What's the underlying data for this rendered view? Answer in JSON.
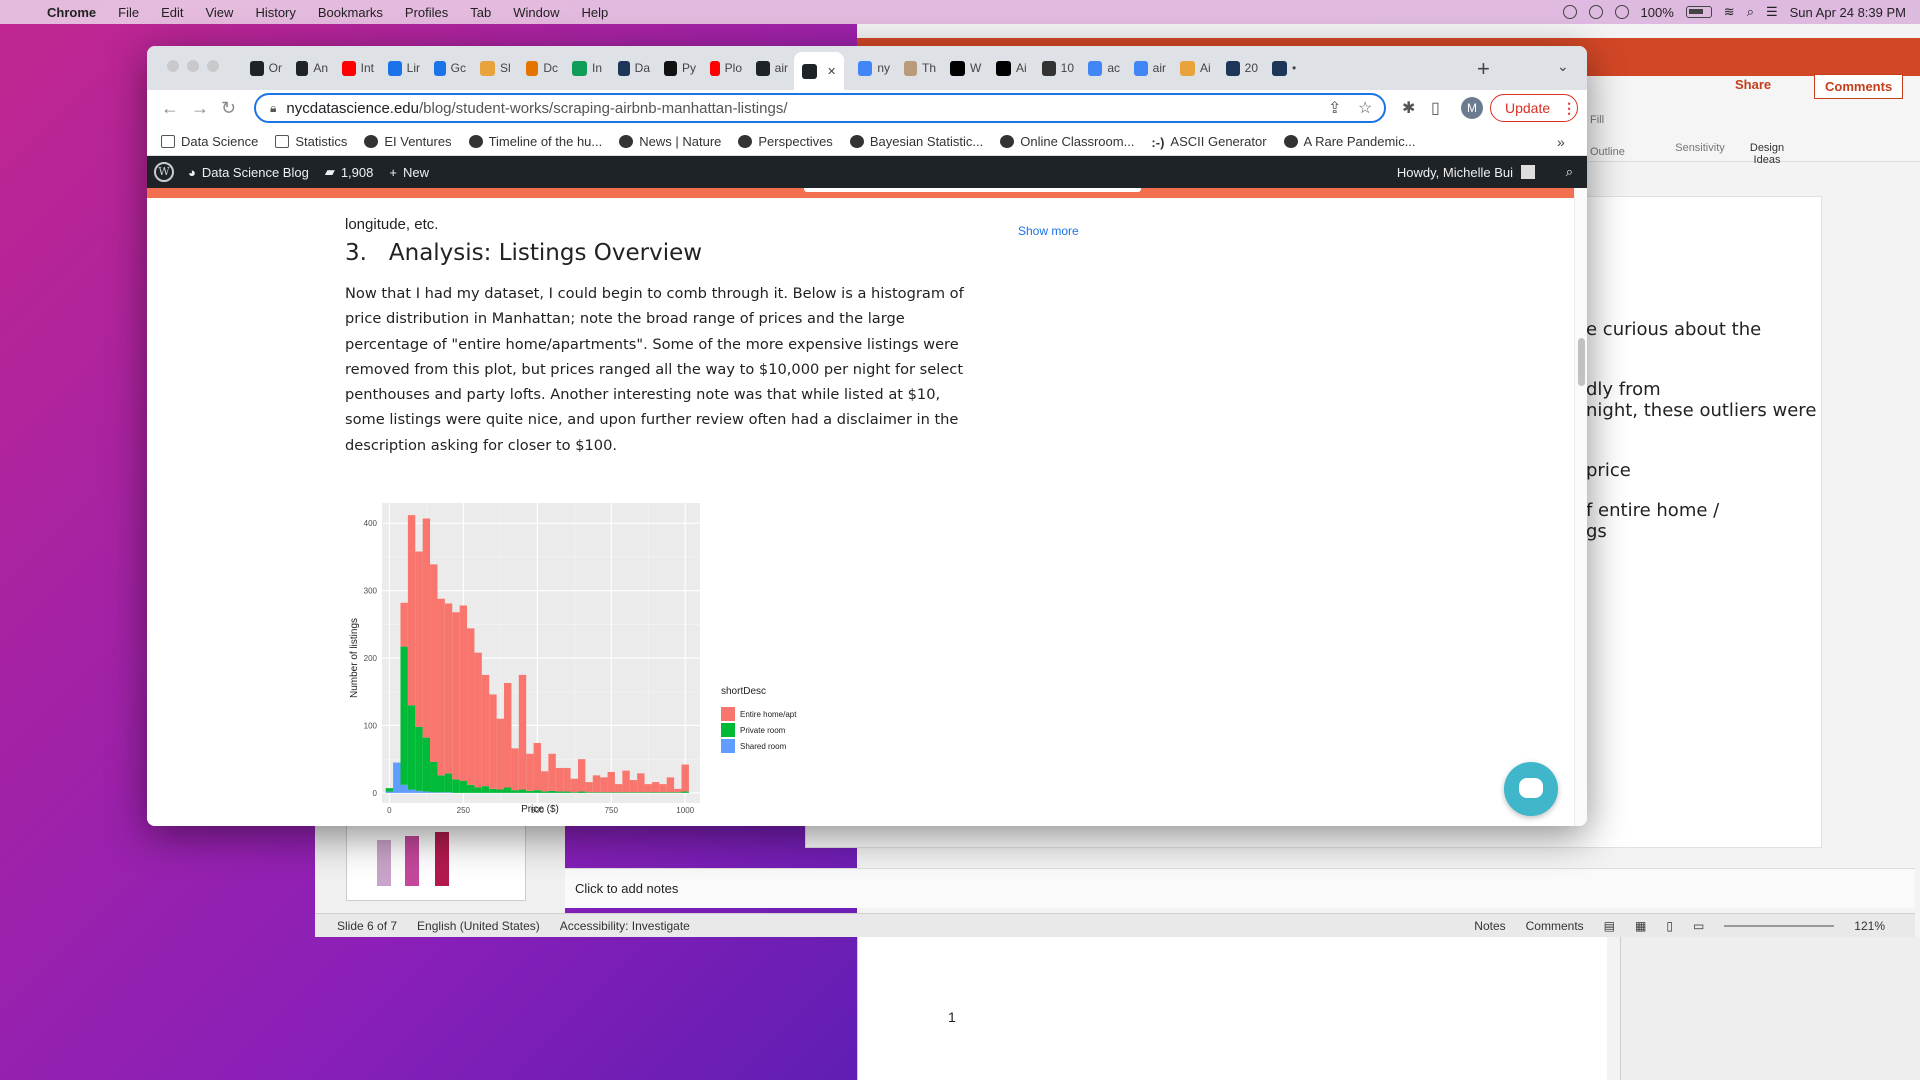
{
  "menubar": {
    "app": "Chrome",
    "items": [
      "File",
      "Edit",
      "View",
      "History",
      "Bookmarks",
      "Profiles",
      "Tab",
      "Window",
      "Help"
    ],
    "battery": "100%",
    "datetime": "Sun Apr 24  8:39 PM"
  },
  "chrome": {
    "tabs": [
      {
        "label": "Or",
        "color": "#1d2327"
      },
      {
        "label": "An",
        "color": "#1d2327"
      },
      {
        "label": "Int",
        "color": "#ff0000"
      },
      {
        "label": "Lir",
        "color": "#1a73e8"
      },
      {
        "label": "Gc",
        "color": "#1a73e8"
      },
      {
        "label": "Sl",
        "color": "#e8a33d"
      },
      {
        "label": "Dc",
        "color": "#e37400"
      },
      {
        "label": "In",
        "color": "#0f9d58"
      },
      {
        "label": "Da",
        "color": "#1d3557"
      },
      {
        "label": "Py",
        "color": "#111111"
      },
      {
        "label": "Plo",
        "color": "#ff0000"
      },
      {
        "label": "air",
        "color": "#1d2327"
      },
      {
        "label": "",
        "color": "#1d2327",
        "active": true
      },
      {
        "label": "ny",
        "color": "#4285f4"
      },
      {
        "label": "Th",
        "color": "#b99a7a"
      },
      {
        "label": "W",
        "color": "#000000"
      },
      {
        "label": "Ai",
        "color": "#000000"
      },
      {
        "label": "10",
        "color": "#333333"
      },
      {
        "label": "ac",
        "color": "#4285f4"
      },
      {
        "label": "air",
        "color": "#4285f4"
      },
      {
        "label": "Ai",
        "color": "#e8a33d"
      },
      {
        "label": "20",
        "color": "#1d3557"
      },
      {
        "label": "•",
        "color": "#1d3557"
      }
    ],
    "url_host": "nycdatascience.edu",
    "url_path": "/blog/student-works/scraping-airbnb-manhattan-listings/",
    "update_label": "Update",
    "profile_initial": "M",
    "bookmarks": [
      {
        "label": "Data Science",
        "kind": "folder"
      },
      {
        "label": "Statistics",
        "kind": "folder"
      },
      {
        "label": "EI Ventures",
        "kind": "site"
      },
      {
        "label": "Timeline of the hu...",
        "kind": "site"
      },
      {
        "label": "News | Nature",
        "kind": "site"
      },
      {
        "label": "Perspectives",
        "kind": "site"
      },
      {
        "label": "Bayesian Statistic...",
        "kind": "site"
      },
      {
        "label": "Online Classroom...",
        "kind": "site"
      },
      {
        "label": "ASCII Generator",
        "kind": "site",
        "icon_text": ":-)"
      },
      {
        "label": "A Rare Pandemic...",
        "kind": "site"
      }
    ]
  },
  "wpbar": {
    "site": "Data Science Blog",
    "comments": "1,908",
    "new": "New",
    "howdy": "Howdy, Michelle Bui"
  },
  "article": {
    "fragment": "longitude, etc.",
    "heading_num": "3.",
    "heading": "Analysis: Listings Overview",
    "paragraph": "Now that I had my dataset, I could begin to comb through it. Below is a histogram of price distribution in Manhattan; note the broad range of prices and the large percentage of \"entire home/apartments\". Some of the more expensive listings were removed from this plot, but prices ranged all the way to $10,000 per night for select penthouses and party lofts. Another interesting note was that while listed at $10, some listings were quite nice, and upon further review often had a disclaimer in the description asking for closer to $100.",
    "show_more": "Show more"
  },
  "chart_data": {
    "type": "bar",
    "xlabel": "Price ($)",
    "ylabel": "Number of listings",
    "xlim": [
      -25,
      1050
    ],
    "ylim": [
      -15,
      430
    ],
    "xticks": [
      0,
      250,
      500,
      750,
      1000
    ],
    "yticks": [
      0,
      100,
      200,
      300,
      400
    ],
    "bin_width": 25,
    "grid": true,
    "legend_title": "shortDesc",
    "legend_position": "right",
    "series": [
      {
        "name": "Entire home/apt",
        "color": "#f8766d",
        "x": [
          50,
          75,
          100,
          125,
          150,
          175,
          200,
          225,
          250,
          275,
          300,
          325,
          350,
          375,
          400,
          425,
          450,
          475,
          500,
          525,
          550,
          575,
          600,
          625,
          650,
          675,
          700,
          725,
          750,
          775,
          800,
          825,
          850,
          875,
          900,
          925,
          950,
          975,
          1000
        ],
        "values": [
          65,
          282,
          260,
          325,
          293,
          262,
          252,
          248,
          260,
          232,
          200,
          165,
          140,
          105,
          155,
          62,
          170,
          55,
          70,
          30,
          55,
          35,
          35,
          20,
          48,
          15,
          25,
          22,
          30,
          12,
          32,
          18,
          28,
          12,
          15,
          12,
          22,
          5,
          40
        ]
      },
      {
        "name": "Private room",
        "color": "#00ba38",
        "x": [
          0,
          25,
          50,
          75,
          100,
          125,
          150,
          175,
          200,
          225,
          250,
          275,
          300,
          325,
          350,
          375,
          400,
          425,
          450,
          475,
          500,
          525,
          550,
          575,
          600,
          625,
          650,
          675,
          700,
          725,
          750,
          775,
          800,
          825,
          850,
          875,
          900,
          925,
          950,
          975,
          1000
        ],
        "values": [
          5,
          0,
          205,
          125,
          95,
          80,
          45,
          25,
          28,
          20,
          18,
          12,
          8,
          10,
          6,
          5,
          8,
          4,
          5,
          3,
          4,
          2,
          3,
          2,
          2,
          1,
          2,
          1,
          1,
          1,
          1,
          1,
          1,
          1,
          1,
          1,
          1,
          1,
          1,
          1,
          2
        ]
      },
      {
        "name": "Shared room",
        "color": "#619cff",
        "x": [
          0,
          25,
          50,
          75,
          100,
          125,
          150,
          175,
          200
        ],
        "values": [
          2,
          45,
          12,
          5,
          3,
          2,
          1,
          1,
          1
        ]
      }
    ]
  },
  "ppt": {
    "share": "Share",
    "comments": "Comments",
    "fill": "Fill",
    "outline": "Outline",
    "sensitivity": "Sensitivity",
    "design_ideas_1": "Design",
    "design_ideas_2": "Ideas",
    "slide_lines": [
      "e curious about the",
      "dly from",
      "night, these outliers were",
      "price",
      "f entire home /",
      "gs"
    ],
    "notes_placeholder": "Click to add notes",
    "status_slide": "Slide 6 of 7",
    "status_lang": "English (United States)",
    "status_access": "Accessibility: Investigate",
    "status_notes": "Notes",
    "status_comments": "Comments",
    "zoom": "121%",
    "word_page_num": "1"
  },
  "colors": {
    "accent": "#1a73e8",
    "wp_orange": "#f26f4f",
    "ppt_orange": "#d24726",
    "chat": "#3fb6c9"
  }
}
